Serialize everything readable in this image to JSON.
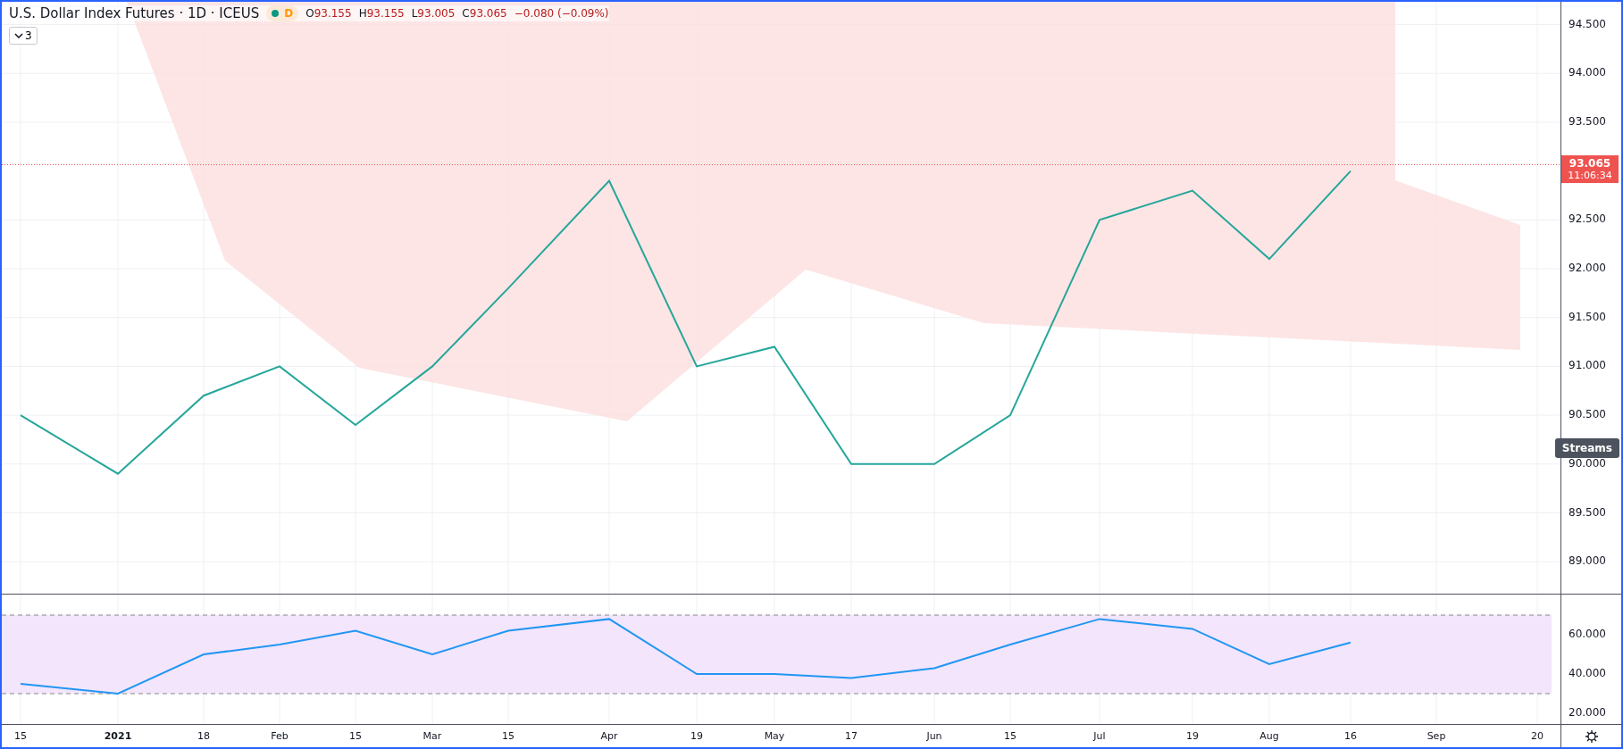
{
  "header": {
    "symbol": "U.S. Dollar Index Futures · 1D · ICEUS",
    "interval": "D",
    "ohlc": [
      {
        "label": "O",
        "value": "93.155"
      },
      {
        "label": "H",
        "value": "93.155"
      },
      {
        "label": "L",
        "value": "93.005"
      },
      {
        "label": "C",
        "value": "93.065"
      }
    ],
    "change": "−0.080 (−0.09%)"
  },
  "indicators_toggle": {
    "count": "3"
  },
  "price_axis": {
    "labels": [
      "94.500",
      "94.000",
      "93.500",
      "92.500",
      "92.000",
      "91.500",
      "91.000",
      "90.500",
      "90.000",
      "89.500",
      "89.000"
    ],
    "last_price": "93.065",
    "countdown": "11:06:34"
  },
  "tooltip": "Streams",
  "rsi_axis": {
    "labels": [
      "60.000",
      "40.000",
      "20.000"
    ]
  },
  "time_axis": {
    "labels": [
      {
        "text": "15",
        "year": false
      },
      {
        "text": "2021",
        "year": true
      },
      {
        "text": "18",
        "year": false
      },
      {
        "text": "Feb",
        "year": false
      },
      {
        "text": "15",
        "year": false
      },
      {
        "text": "Mar",
        "year": false
      },
      {
        "text": "15",
        "year": false
      },
      {
        "text": "Apr",
        "year": false
      },
      {
        "text": "19",
        "year": false
      },
      {
        "text": "May",
        "year": false
      },
      {
        "text": "17",
        "year": false
      },
      {
        "text": "Jun",
        "year": false
      },
      {
        "text": "15",
        "year": false
      },
      {
        "text": "Jul",
        "year": false
      },
      {
        "text": "19",
        "year": false
      },
      {
        "text": "Aug",
        "year": false
      },
      {
        "text": "16",
        "year": false
      },
      {
        "text": "Sep",
        "year": false
      },
      {
        "text": "20",
        "year": false
      }
    ]
  }
}
